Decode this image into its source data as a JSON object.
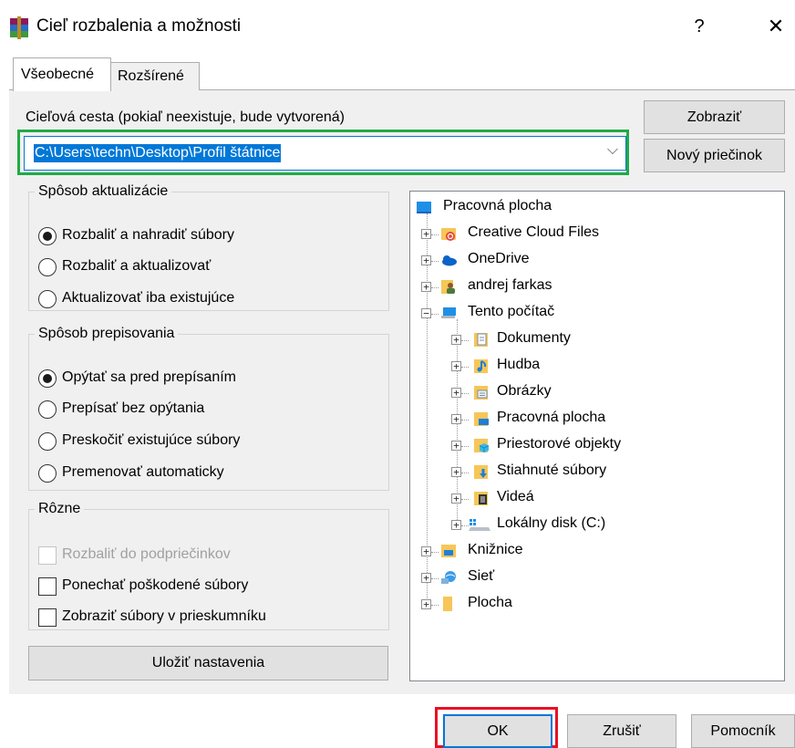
{
  "window": {
    "title": "Cieľ rozbalenia a možnosti",
    "help_glyph": "?",
    "close_glyph": "✕"
  },
  "tabs": [
    {
      "label": "Všeobecné",
      "active": true
    },
    {
      "label": "Rozšírené",
      "active": false
    }
  ],
  "destination": {
    "label": "Cieľová cesta (pokiaľ neexistuje, bude vytvorená)",
    "value": "C:\\Users\\techn\\Desktop\\Profil štátnice",
    "show_label": "Zobraziť",
    "new_folder_label": "Nový priečinok"
  },
  "update_mode": {
    "title": "Spôsob aktualizácie",
    "options": [
      {
        "label": "Rozbaliť a nahradiť súbory",
        "selected": true
      },
      {
        "label": "Rozbaliť a aktualizovať",
        "selected": false
      },
      {
        "label": "Aktualizovať iba existujúce",
        "selected": false
      }
    ]
  },
  "overwrite_mode": {
    "title": "Spôsob prepisovania",
    "options": [
      {
        "label": "Opýtať sa pred prepísaním",
        "selected": true
      },
      {
        "label": "Prepísať bez opýtania",
        "selected": false
      },
      {
        "label": "Preskočiť existujúce súbory",
        "selected": false
      },
      {
        "label": "Premenovať automaticky",
        "selected": false
      }
    ]
  },
  "misc": {
    "title": "Rôzne",
    "options": [
      {
        "label": "Rozbaliť do podpriečinkov",
        "checked": false,
        "disabled": true
      },
      {
        "label": "Ponechať poškodené súbory",
        "checked": false,
        "disabled": false
      },
      {
        "label": "Zobraziť súbory v prieskumníku",
        "checked": false,
        "disabled": false
      }
    ]
  },
  "save_settings_label": "Uložiť nastavenia",
  "tree": {
    "root": "Pracovná plocha",
    "items": [
      {
        "label": "Creative Cloud Files",
        "icon": "creative-cloud-icon"
      },
      {
        "label": "OneDrive",
        "icon": "onedrive-icon"
      },
      {
        "label": "andrej farkas",
        "icon": "user-folder-icon"
      },
      {
        "label": "Tento počítač",
        "icon": "computer-icon"
      },
      {
        "label": "Dokumenty",
        "icon": "documents-folder-icon"
      },
      {
        "label": "Hudba",
        "icon": "music-folder-icon"
      },
      {
        "label": "Obrázky",
        "icon": "pictures-folder-icon"
      },
      {
        "label": "Pracovná plocha",
        "icon": "desktop-folder-icon"
      },
      {
        "label": "Priestorové objekty",
        "icon": "3d-objects-folder-icon"
      },
      {
        "label": "Stiahnuté súbory",
        "icon": "downloads-folder-icon"
      },
      {
        "label": "Videá",
        "icon": "videos-folder-icon"
      },
      {
        "label": "Lokálny disk (C:)",
        "icon": "local-disk-icon"
      },
      {
        "label": "Knižnice",
        "icon": "libraries-folder-icon"
      },
      {
        "label": "Sieť",
        "icon": "network-icon"
      },
      {
        "label": "Plocha",
        "icon": "folder-icon"
      }
    ]
  },
  "buttons": {
    "ok": "OK",
    "cancel": "Zrušiť",
    "help": "Pomocník"
  },
  "colors": {
    "accent": "#0078d7",
    "highlight_green": "#22aa44",
    "highlight_red": "#e81123",
    "panel_bg": "#f0f0f0"
  }
}
